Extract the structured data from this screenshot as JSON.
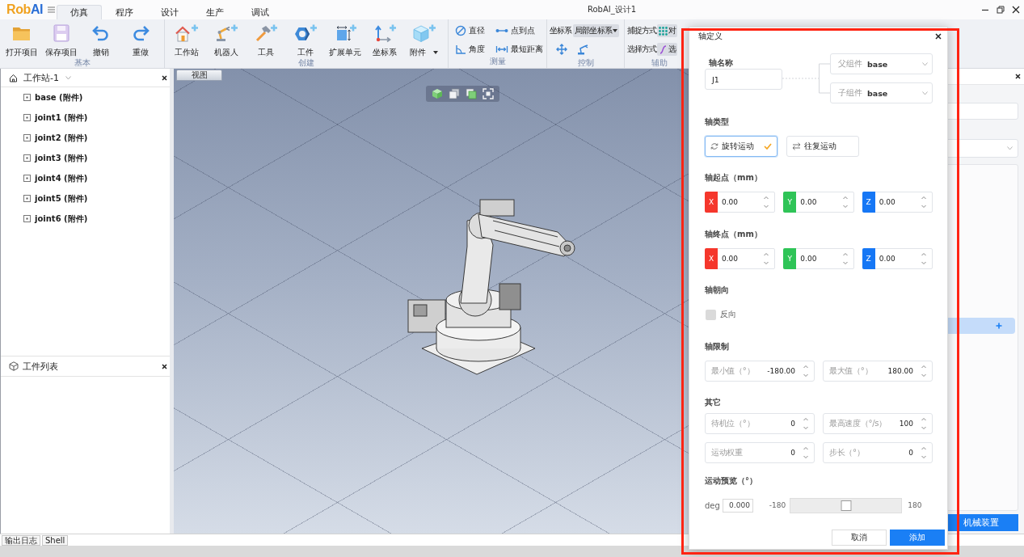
{
  "logo": {
    "primary": "Rob",
    "accent": "AI"
  },
  "menu_tabs": [
    {
      "label": "仿真",
      "selected": true
    },
    {
      "label": "程序",
      "selected": false
    },
    {
      "label": "设计",
      "selected": false
    },
    {
      "label": "生产",
      "selected": false
    },
    {
      "label": "调试",
      "selected": false
    }
  ],
  "window": {
    "title": "RobAI_设计1"
  },
  "ribbon": {
    "groups": [
      {
        "kind": "large",
        "label": "基本",
        "tools": [
          {
            "label": "打开项目",
            "dropdown": false
          },
          {
            "label": "保存项目",
            "dropdown": false
          },
          {
            "label": "撤销",
            "dropdown": false
          },
          {
            "label": "重做",
            "dropdown": false
          }
        ]
      },
      {
        "kind": "large",
        "label": "创建",
        "tools": [
          {
            "label": "工作站",
            "dropdown": false
          },
          {
            "label": "机器人",
            "dropdown": false
          },
          {
            "label": "工具",
            "dropdown": false
          },
          {
            "label": "工件",
            "dropdown": false
          },
          {
            "label": "扩展单元",
            "dropdown": false
          },
          {
            "label": "坐标系",
            "dropdown": false
          },
          {
            "label": "附件",
            "dropdown": true
          }
        ]
      },
      {
        "kind": "compact",
        "label": "测量",
        "tools": [
          {
            "label": "直径"
          },
          {
            "label": "点到点"
          },
          {
            "label": "角度"
          },
          {
            "label": "最短距离"
          }
        ]
      },
      {
        "kind": "coords",
        "label": "控制",
        "field_label": "坐标系",
        "select_value": "局部坐标系"
      },
      {
        "kind": "modes",
        "label": "辅助",
        "rows": [
          {
            "label": "捕捉方式",
            "value": "对"
          },
          {
            "label": "选择方式",
            "value": "选"
          }
        ]
      }
    ]
  },
  "station_panel": {
    "title": "工作站-1",
    "items": [
      {
        "label": "base (附件)"
      },
      {
        "label": "joint1 (附件)"
      },
      {
        "label": "joint2 (附件)"
      },
      {
        "label": "joint3 (附件)"
      },
      {
        "label": "joint4 (附件)"
      },
      {
        "label": "joint5 (附件)"
      },
      {
        "label": "joint6 (附件)"
      }
    ]
  },
  "parts_panel": {
    "title": "工件列表"
  },
  "viewport": {
    "tab": "视图"
  },
  "right_panel": {
    "button": "机械装置"
  },
  "bottom_tabs": [
    {
      "label": "输出日志"
    },
    {
      "label": "Shell"
    }
  ],
  "dialog": {
    "title": "轴定义",
    "name_field": {
      "label": "轴名称",
      "value": "J1"
    },
    "component_selects": [
      {
        "label": "父组件",
        "value": "base"
      },
      {
        "label": "子组件",
        "value": "base"
      }
    ],
    "axis_type": {
      "label": "轴类型",
      "options": [
        {
          "label": "旋转运动",
          "selected": true
        },
        {
          "label": "往复运动",
          "selected": false
        }
      ]
    },
    "start_point": {
      "label": "轴起点（mm）",
      "coords": [
        {
          "axis": "X",
          "value": "0.00",
          "color": "#f5372c"
        },
        {
          "axis": "Y",
          "value": "0.00",
          "color": "#2fc457"
        },
        {
          "axis": "Z",
          "value": "0.00",
          "color": "#1677f5"
        }
      ]
    },
    "end_point": {
      "label": "轴终点（mm）",
      "coords": [
        {
          "axis": "X",
          "value": "0.00",
          "color": "#f5372c"
        },
        {
          "axis": "Y",
          "value": "0.00",
          "color": "#2fc457"
        },
        {
          "axis": "Z",
          "value": "0.00",
          "color": "#1677f5"
        }
      ]
    },
    "orientation": {
      "label": "轴朝向",
      "checkbox": {
        "label": "反向",
        "checked": false
      }
    },
    "limits": {
      "label": "轴限制",
      "fields": [
        {
          "label": "最小值（°）",
          "value": "-180.00"
        },
        {
          "label": "最大值（°）",
          "value": "180.00"
        }
      ]
    },
    "other": {
      "label": "其它",
      "fields": [
        {
          "label": "待机位（°）",
          "value": "0"
        },
        {
          "label": "最高速度（°/s）",
          "value": "100"
        },
        {
          "label": "运动权重",
          "value": "0"
        },
        {
          "label": "步长（°）",
          "value": "0"
        }
      ]
    },
    "preview": {
      "label": "运动预览（°）",
      "unit": "deg",
      "value": "0.000",
      "min_label": "-180",
      "max_label": "180",
      "level": 0.5
    },
    "buttons": [
      {
        "label": "取消",
        "kind": "secondary"
      },
      {
        "label": "添加",
        "kind": "primary"
      }
    ]
  }
}
